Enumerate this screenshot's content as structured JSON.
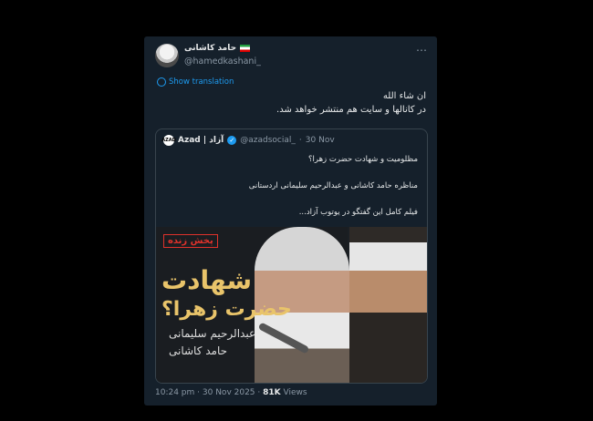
{
  "tweet": {
    "author_name": "حامد کاشانی",
    "handle": "@hamedkashani_",
    "more_icon": "⋯",
    "show_translation": "Show translation",
    "text_line1": "ان شاء الله",
    "text_line2": "در کانالها و سایت هم منتشر خواهد شد."
  },
  "quote": {
    "logo_text": "AZAD",
    "name": "Azad | آزاد",
    "handle": "@azadsocial_",
    "date": "30 Nov",
    "lines": [
      "مظلومیت و شهادت حضرت زهرا؟",
      "مناظره حامد کاشانی و عبدالرحیم سلیمانی اردستانی",
      "فیلم کامل این گفتگو در یوتوب آزاد..."
    ],
    "media": {
      "live_badge": "پخش زنده",
      "headline1": "شهادت",
      "headline2": "حضرت زهرا؟",
      "name1": "عبدالرحیم سلیمانی",
      "name2": "حامد کاشانی"
    }
  },
  "footer": {
    "time": "10:24 pm",
    "date": "30 Nov 2025",
    "views_count": "81K",
    "views_label": "Views"
  }
}
